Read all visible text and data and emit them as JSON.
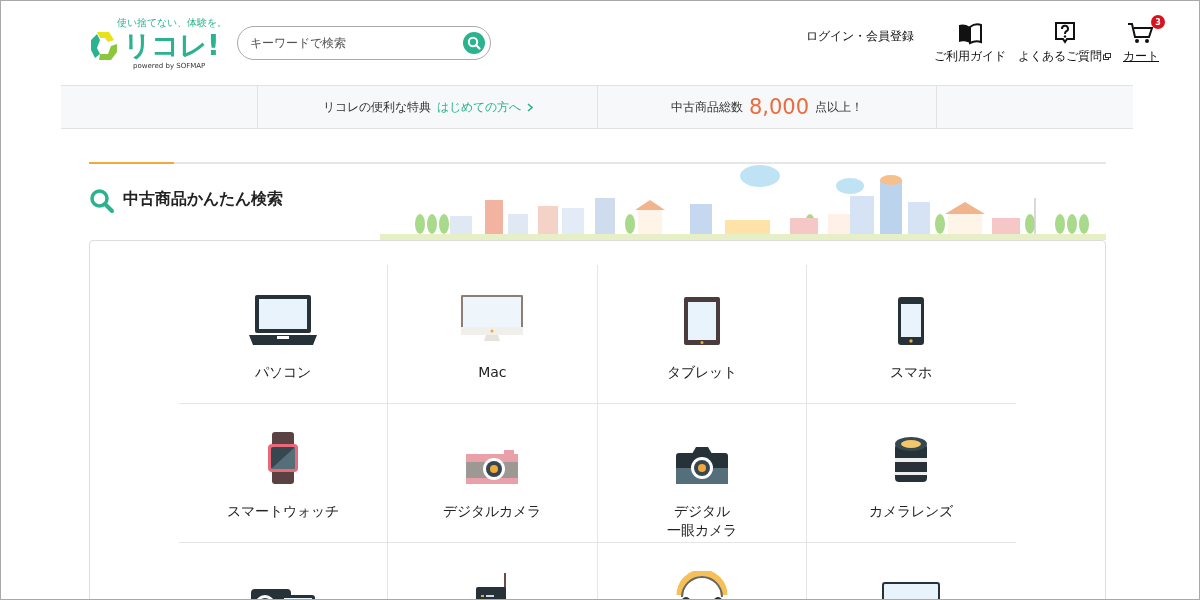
{
  "header": {
    "logo": {
      "tagline": "使い捨てない、体験を。",
      "name": "リコレ!",
      "sub": "powered by SOFMAP"
    },
    "search": {
      "placeholder": "キーワードで検索"
    },
    "login": "ログイン・会員登録",
    "nav": [
      {
        "kind": "guide",
        "label": "ご利用ガイド"
      },
      {
        "kind": "faq",
        "label": "よくあるご質問"
      },
      {
        "kind": "cart",
        "label": "カート",
        "badge": "3"
      }
    ]
  },
  "banner": {
    "benefit": "リコレの便利な特典",
    "benefit_link": "はじめての方へ",
    "count_prefix": "中古商品総数",
    "count": "8,000",
    "count_suffix": "点以上！"
  },
  "section": {
    "title": "中古商品かんたん検索"
  },
  "categories": [
    {
      "kind": "laptop",
      "label": "パソコン"
    },
    {
      "kind": "monitor",
      "label": "Mac"
    },
    {
      "kind": "tablet",
      "label": "タブレット"
    },
    {
      "kind": "phone",
      "label": "スマホ"
    },
    {
      "kind": "watch",
      "label": "スマートウォッチ"
    },
    {
      "kind": "compact",
      "label": "デジタルカメラ"
    },
    {
      "kind": "slr",
      "label": "デジタル",
      "label_line2": "一眼カメラ"
    },
    {
      "kind": "lens",
      "label": "カメラレンズ"
    },
    {
      "kind": "video"
    },
    {
      "kind": "router"
    },
    {
      "kind": "headphones"
    },
    {
      "kind": "display"
    }
  ]
}
